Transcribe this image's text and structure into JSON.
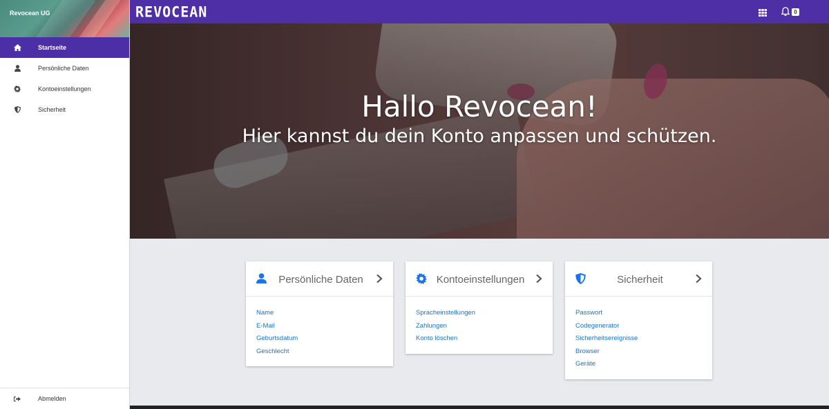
{
  "sidebar": {
    "brand": "Revocean UG",
    "items": [
      {
        "label": "Startseite",
        "icon": "home-icon"
      },
      {
        "label": "Persönliche Daten",
        "icon": "user-icon"
      },
      {
        "label": "Kontoeinstellungen",
        "icon": "gear-icon"
      },
      {
        "label": "Sicherheit",
        "icon": "shield-icon"
      }
    ],
    "logout": {
      "label": "Abmelden",
      "icon": "sign-out-icon"
    }
  },
  "topbar": {
    "logo": "REVOCEAN",
    "apps_icon": "grid-icon",
    "notifications_icon": "bell-icon",
    "notification_count": "0"
  },
  "hero": {
    "title": "Hallo Revocean!",
    "subtitle": "Hier kannst du dein Konto anpassen und schützen."
  },
  "cards": [
    {
      "title": "Persönliche Daten",
      "icon": "user-icon",
      "links": [
        "Name",
        "E-Mail",
        "Geburtsdatum",
        "Geschlecht"
      ]
    },
    {
      "title": "Kontoeinstellungen",
      "icon": "gear-icon",
      "links": [
        "Spracheinstellungen",
        "Zahlungen",
        "Konto löschen"
      ]
    },
    {
      "title": "Sicherheit",
      "icon": "shield-icon",
      "links": [
        "Passwort",
        "Codegenerator",
        "Sicherheitsereignisse",
        "Browser",
        "Geräte"
      ]
    }
  ],
  "colors": {
    "primary": "#4f2fa6",
    "sidebar_active": "#4c2ea6",
    "link": "#1a73c8",
    "icon_blue": "#1a73e8"
  }
}
